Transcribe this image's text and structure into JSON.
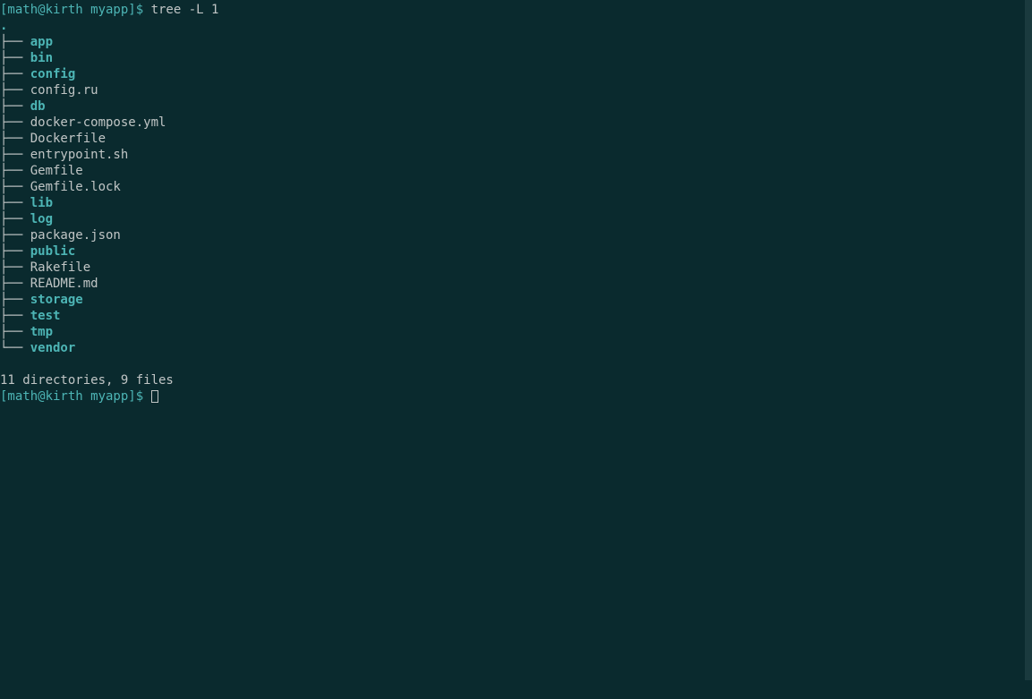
{
  "prompt1": "[math@kirth myapp]$ ",
  "command1": "tree -L 1",
  "root": ".",
  "branches": {
    "mid": "├── ",
    "last": "└── "
  },
  "items": [
    {
      "name": "app",
      "type": "dir",
      "last": false
    },
    {
      "name": "bin",
      "type": "dir",
      "last": false
    },
    {
      "name": "config",
      "type": "dir",
      "last": false
    },
    {
      "name": "config.ru",
      "type": "file",
      "last": false
    },
    {
      "name": "db",
      "type": "dir",
      "last": false
    },
    {
      "name": "docker-compose.yml",
      "type": "file",
      "last": false
    },
    {
      "name": "Dockerfile",
      "type": "file",
      "last": false
    },
    {
      "name": "entrypoint.sh",
      "type": "file",
      "last": false
    },
    {
      "name": "Gemfile",
      "type": "file",
      "last": false
    },
    {
      "name": "Gemfile.lock",
      "type": "file",
      "last": false
    },
    {
      "name": "lib",
      "type": "dir",
      "last": false
    },
    {
      "name": "log",
      "type": "dir",
      "last": false
    },
    {
      "name": "package.json",
      "type": "file",
      "last": false
    },
    {
      "name": "public",
      "type": "dir",
      "last": false
    },
    {
      "name": "Rakefile",
      "type": "file",
      "last": false
    },
    {
      "name": "README.md",
      "type": "file",
      "last": false
    },
    {
      "name": "storage",
      "type": "dir",
      "last": false
    },
    {
      "name": "test",
      "type": "dir",
      "last": false
    },
    {
      "name": "tmp",
      "type": "dir",
      "last": false
    },
    {
      "name": "vendor",
      "type": "dir",
      "last": true
    }
  ],
  "summary": "11 directories, 9 files",
  "prompt2": "[math@kirth myapp]$ "
}
